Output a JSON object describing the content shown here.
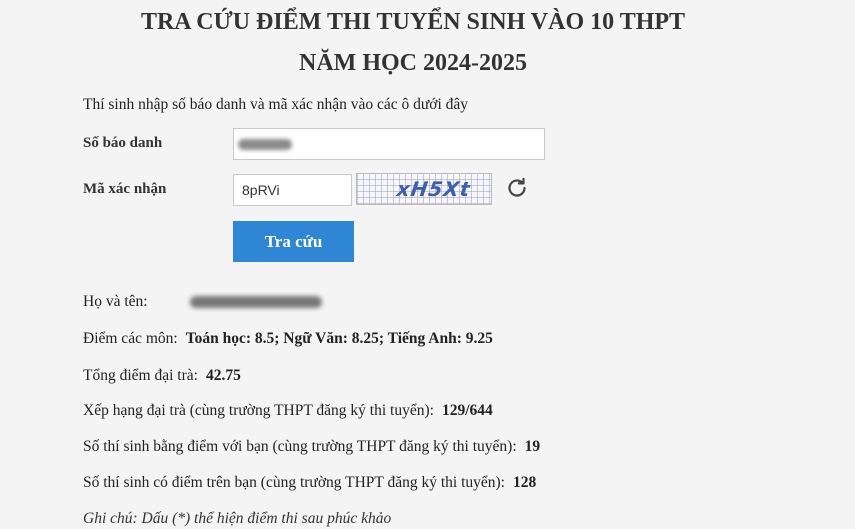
{
  "header": {
    "title_line1": "TRA CỨU ĐIỂM THI TUYỂN SINH VÀO 10 THPT",
    "title_line2": "NĂM HỌC 2024-2025"
  },
  "form": {
    "intro": "Thí sinh nhập số báo danh và mã xác nhận vào các ô dưới đây",
    "sbd_label": "Số báo danh",
    "sbd_value": "",
    "captcha_label": "Mã xác nhận",
    "captcha_input_value": "8pRVi",
    "captcha_image_text": "xH5Xt",
    "refresh_icon": "refresh-icon",
    "submit_label": "Tra cứu"
  },
  "result": {
    "name_label": "Họ và tên:",
    "scores_label": "Điểm các môn:",
    "scores_value": "Toán học: 8.5; Ngữ Văn: 8.25; Tiếng Anh: 9.25",
    "total_label": "Tổng điểm đại trà:",
    "total_value": "42.75",
    "rank_label": "Xếp hạng đại trà (cùng trường THPT đăng ký thi tuyển):",
    "rank_value": "129/644",
    "same_label": "Số thí sinh bằng điểm với bạn (cùng trường THPT đăng ký thi tuyển):",
    "same_value": "19",
    "above_label": "Số thí sinh có điểm trên bạn (cùng trường THPT đăng ký thi tuyển):",
    "above_value": "128",
    "note": "Ghi chú: Dấu (*) thể hiện điểm thi sau phúc khảo"
  },
  "colors": {
    "button_bg": "#2f86d4",
    "captcha_text": "#3c5eb3"
  }
}
